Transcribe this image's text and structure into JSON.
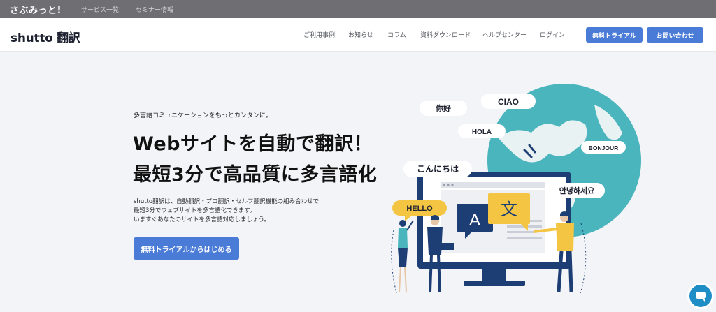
{
  "topbar": {
    "brand": "さぶみっと!",
    "links": [
      "サービス一覧",
      "セミナー情報"
    ]
  },
  "header": {
    "logo": "shutto 翻訳",
    "nav": [
      "ご利用事例",
      "お知らせ",
      "コラム",
      "資料ダウンロード",
      "ヘルプセンター",
      "ログイン"
    ],
    "trial_button": "無料トライアル",
    "contact_button": "お問い合わせ"
  },
  "hero": {
    "tagline": "多言語コミュニケーションをもっとカンタンに。",
    "title_line1": "Webサイトを自動で翻訳！",
    "title_line2": "最短3分で高品質に多言語化",
    "desc_line1": "shutto翻訳は、自動翻訳・プロ翻訳・セルフ翻訳機能の組み合わせで",
    "desc_line2": "最短3分でウェブサイトを多言語化できます。",
    "desc_line3": "いますぐあなたのサイトを多言語対応しましょう。",
    "cta": "無料トライアルからはじめる"
  },
  "illustration": {
    "bubbles": [
      "你好",
      "CIAO",
      "HOLA",
      "BONJOUR",
      "こんにちは",
      "안녕하세요",
      "HELLO"
    ],
    "card_a": "A",
    "card_wen": "文"
  },
  "colors": {
    "accent": "#4a7bd6",
    "topbar": "#6e6e73",
    "globe": "#4ab5bd",
    "monitor": "#1d3e74",
    "hello_bubble": "#f4c542"
  },
  "chat_widget": {
    "icon": "chat-icon"
  }
}
